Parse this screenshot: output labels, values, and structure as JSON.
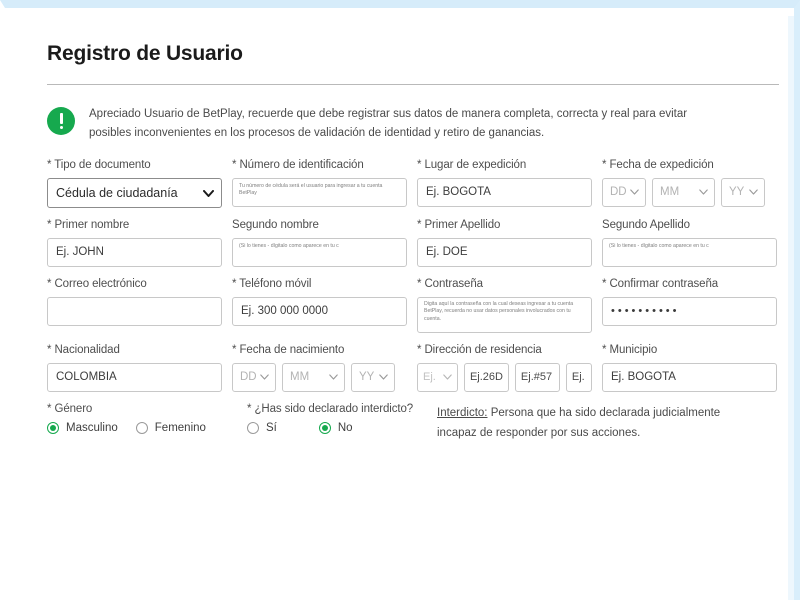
{
  "page": {
    "title": "Registro de Usuario",
    "accent_green": "#16a94e",
    "border_blue": "#d6ecfa"
  },
  "alert": {
    "icon": "exclamation-circle-icon",
    "text": "Apreciado Usuario de BetPlay, recuerde que debe registrar sus datos de manera completa, correcta y real para evitar posibles inconvenientes en los procesos de validación de identidad y retiro de ganancias."
  },
  "fields": {
    "tipo_documento": {
      "label": "* Tipo de documento",
      "value": "Cédula de ciudadanía"
    },
    "numero_identificacion": {
      "label": "* Número de identificación",
      "placeholder": "Tu número de cédula será el usuario para ingresar a tu cuenta BetPlay",
      "value": ""
    },
    "lugar_expedicion": {
      "label": "* Lugar de expedición",
      "value": "Ej. BOGOTA"
    },
    "fecha_expedicion": {
      "label": "* Fecha de expedición",
      "dd": "DD",
      "mm": "MM",
      "yy": "YY"
    },
    "primer_nombre": {
      "label": "* Primer nombre",
      "value": "Ej. JOHN"
    },
    "segundo_nombre": {
      "label": "Segundo nombre",
      "placeholder": "(Si lo tienes - dígitalo como aparece en tu c"
    },
    "primer_apellido": {
      "label": "* Primer Apellido",
      "value": "Ej. DOE"
    },
    "segundo_apellido": {
      "label": "Segundo Apellido",
      "placeholder": "(Si lo tienes - dígitalo como aparece en tu c"
    },
    "correo_electronico": {
      "label": "* Correo electrónico",
      "value": ""
    },
    "telefono_movil": {
      "label": "* Teléfono móvil",
      "value": "Ej. 300 000 0000"
    },
    "contrasena": {
      "label": "* Contraseña",
      "placeholder": "Digita aquí la contraseña con la cual deseas ingresar a tu cuenta BetPlay, recuerda no usar datos personales involucrados con tu cuenta."
    },
    "confirmar_contrasena": {
      "label": "* Confirmar contraseña",
      "value": "••••••••••"
    },
    "nacionalidad": {
      "label": "* Nacionalidad",
      "value": "COLOMBIA"
    },
    "fecha_nacimiento": {
      "label": "* Fecha de nacimiento",
      "dd": "DD",
      "mm": "MM",
      "yy": "YY"
    },
    "direccion_residencia": {
      "label": "* Dirección de residencia",
      "part1": "Ej.",
      "part2": "Ej.26D",
      "part3": "Ej.#57",
      "part4": "Ej."
    },
    "municipio": {
      "label": "* Municipio",
      "value": "Ej. BOGOTA"
    },
    "genero": {
      "label": "* Género",
      "option_1": "Masculino",
      "option_2": "Femenino",
      "selected": "Masculino"
    },
    "interdicto": {
      "label": "* ¿Has sido declarado interdicto?",
      "option_1": "Sí",
      "option_2": "No",
      "selected": "No"
    }
  },
  "note": {
    "term": "Interdicto:",
    "text": " Persona que ha sido declarada judicialmente incapaz de responder por sus acciones."
  }
}
